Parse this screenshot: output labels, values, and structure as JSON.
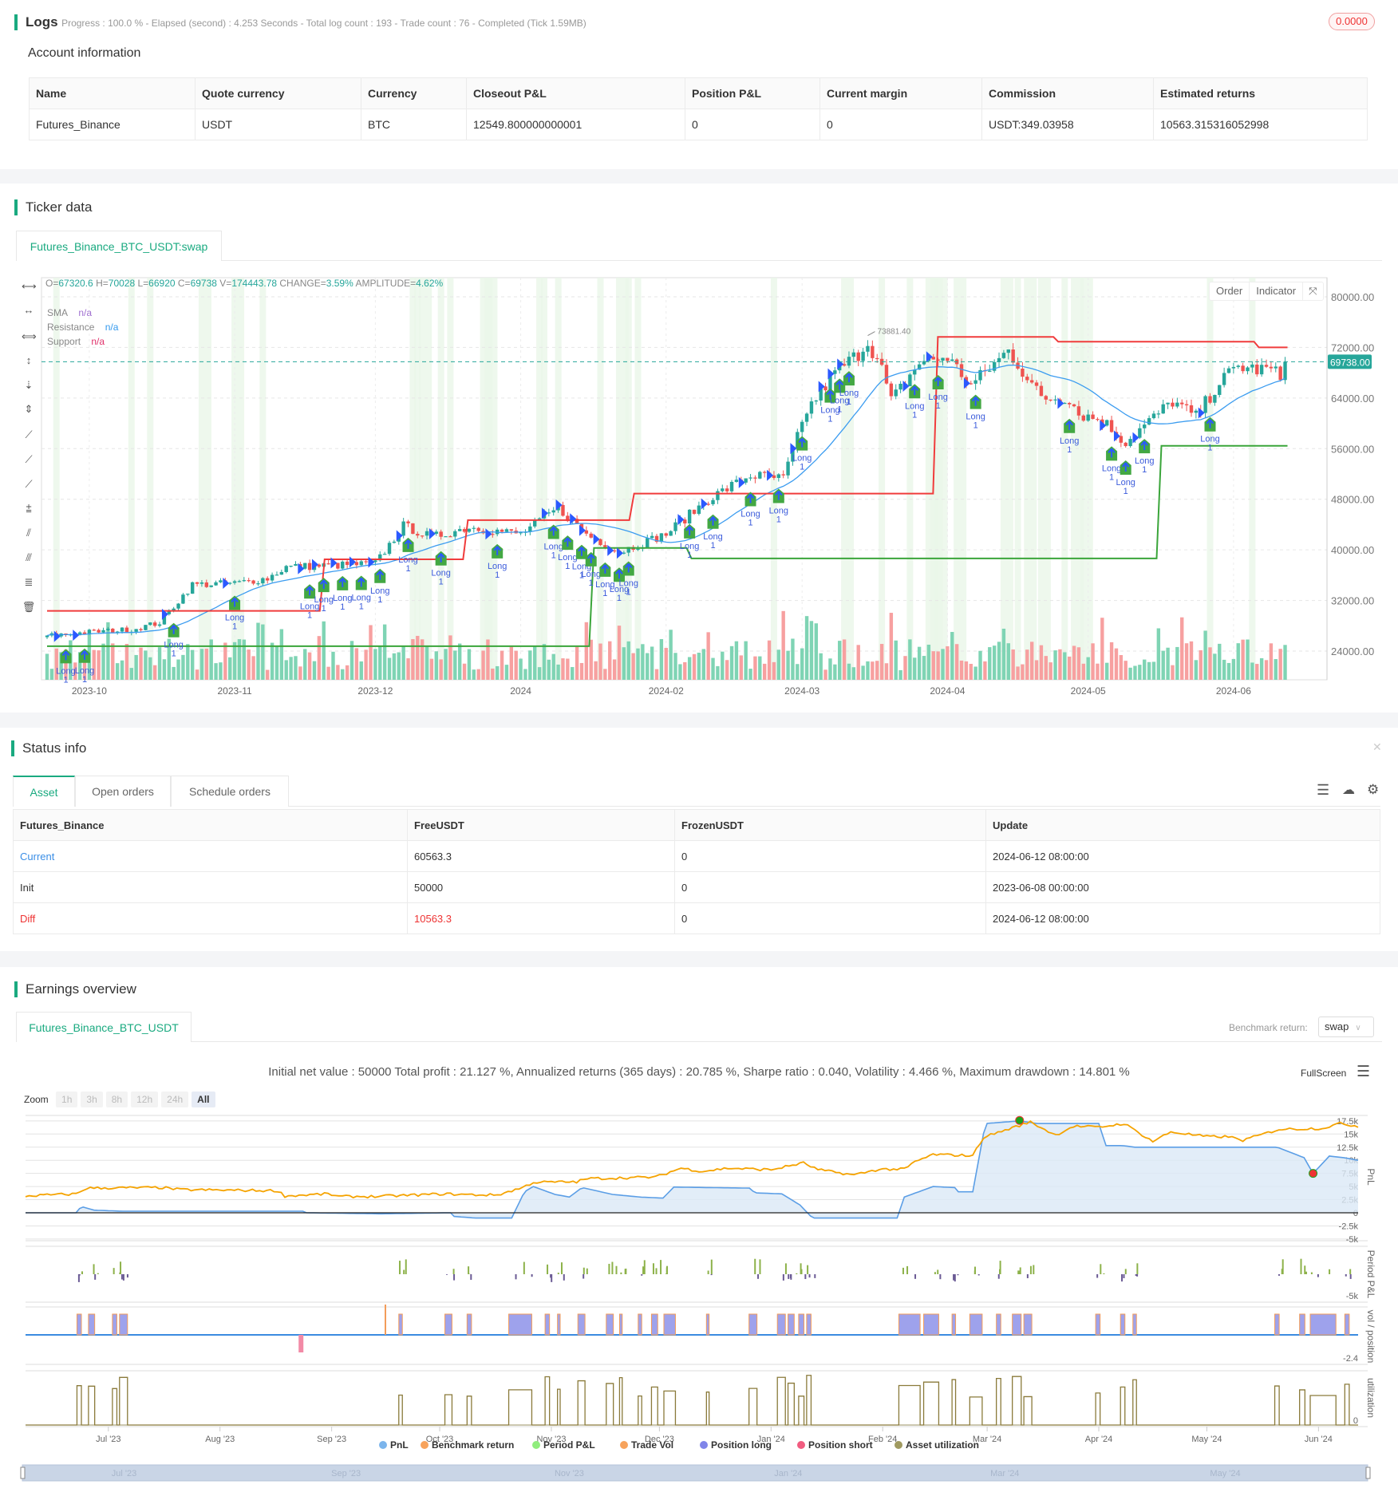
{
  "logs": {
    "title": "Logs",
    "summary": "Progress : 100.0 % - Elapsed (second) : 4.253  Seconds - Total log count : 193 - Trade count : 76 - Completed (Tick 1.59MB)",
    "badge": "0.0000"
  },
  "account": {
    "title": "Account information",
    "headers": [
      "Name",
      "Quote currency",
      "Currency",
      "Closeout P&L",
      "Position P&L",
      "Current margin",
      "Commission",
      "Estimated returns"
    ],
    "row": [
      "Futures_Binance",
      "USDT",
      "BTC",
      "12549.800000000001",
      "0",
      "0",
      "USDT:349.03958",
      "10563.315316052998"
    ]
  },
  "ticker": {
    "title": "Ticker data",
    "tab": "Futures_Binance_BTC_USDT:swap",
    "ohlc": {
      "o_label": "O=",
      "o": "67320.6",
      "h_label": "H=",
      "h": "70028",
      "l_label": "L=",
      "l": "66920",
      "c_label": "C=",
      "c": "69738",
      "v_label": "V=",
      "v": "174443.78",
      "change_label": "CHANGE=",
      "change": "3.59%",
      "amp_label": "AMPLITUDE=",
      "amp": "4.62%"
    },
    "legend": [
      {
        "name": "SMA",
        "value": "n/a",
        "color": "#a070d0"
      },
      {
        "name": "Resistance",
        "value": "n/a",
        "color": "#3399ee"
      },
      {
        "name": "Support",
        "value": "n/a",
        "color": "#e0306a"
      }
    ],
    "buttons": {
      "order": "Order",
      "indicator": "Indicator"
    },
    "price_ticks": [
      "80000.00",
      "72000.00",
      "64000.00",
      "56000.00",
      "48000.00",
      "40000.00",
      "32000.00",
      "24000.00"
    ],
    "last_price": "69738.00",
    "peak_label": "73881.40",
    "date_ticks": [
      "2023-10",
      "2023-11",
      "2023-12",
      "2024",
      "2024-02",
      "2024-03",
      "2024-04",
      "2024-05",
      "2024-06"
    ],
    "marker": {
      "label": "Long",
      "qty": "1"
    },
    "price_path": [
      [
        0,
        26400
      ],
      [
        9,
        27000
      ],
      [
        18,
        27400
      ],
      [
        24,
        28500
      ],
      [
        31,
        34500
      ],
      [
        40,
        34700
      ],
      [
        47,
        35500
      ],
      [
        51,
        37300
      ],
      [
        60,
        37500
      ],
      [
        70,
        37800
      ],
      [
        76,
        43800
      ],
      [
        82,
        42000
      ],
      [
        90,
        43600
      ],
      [
        101,
        42500
      ],
      [
        109,
        46600
      ],
      [
        115,
        42500
      ],
      [
        122,
        39700
      ],
      [
        132,
        42500
      ],
      [
        141,
        48000
      ],
      [
        150,
        51800
      ],
      [
        157,
        51200
      ],
      [
        162,
        62000
      ],
      [
        168,
        68000
      ],
      [
        173,
        71000
      ],
      [
        175,
        73000
      ],
      [
        178,
        68500
      ],
      [
        180,
        63500
      ],
      [
        186,
        69600
      ],
      [
        192,
        70500
      ],
      [
        197,
        66000
      ],
      [
        205,
        71500
      ],
      [
        212,
        64000
      ],
      [
        218,
        64000
      ],
      [
        220,
        61500
      ],
      [
        225,
        60500
      ],
      [
        230,
        57000
      ],
      [
        233,
        59000
      ],
      [
        240,
        63500
      ],
      [
        245,
        61000
      ],
      [
        250,
        66500
      ],
      [
        254,
        69000
      ],
      [
        258,
        68500
      ],
      [
        261,
        68500
      ],
      [
        263,
        67300
      ],
      [
        264,
        69738
      ]
    ],
    "resistance": [
      [
        0,
        30350
      ],
      [
        48,
        38500
      ],
      [
        73,
        44700
      ],
      [
        102,
        48900
      ],
      [
        155,
        73660
      ],
      [
        176,
        72900
      ],
      [
        211,
        72000
      ],
      [
        216,
        72000
      ]
    ],
    "support": [
      [
        0,
        24770
      ],
      [
        95,
        40300
      ],
      [
        112,
        38650
      ],
      [
        194,
        56450
      ],
      [
        216,
        56450
      ]
    ],
    "colors": {
      "up": "#26a69a",
      "down": "#ef5350",
      "resistance": "#f03c3c",
      "support": "#3aa53a",
      "sma": "#3b9cf0"
    }
  },
  "status": {
    "title": "Status info",
    "tabs": [
      "Asset",
      "Open orders",
      "Schedule orders"
    ],
    "headers": [
      "Futures_Binance",
      "FreeUSDT",
      "FrozenUSDT",
      "Update"
    ],
    "rows": [
      [
        "Current",
        "60563.3",
        "0",
        "2024-06-12 08:00:00"
      ],
      [
        "Init",
        "50000",
        "0",
        "2023-06-08 00:00:00"
      ],
      [
        "Diff",
        "10563.3",
        "0",
        "2024-06-12 08:00:00"
      ]
    ]
  },
  "earnings": {
    "title": "Earnings overview",
    "tab": "Futures_Binance_BTC_USDT",
    "benchmark_label": "Benchmark return:",
    "benchmark_value": "swap",
    "summary": "Initial net value : 50000 Total profit : 21.127 %, Annualized returns (365 days) : 20.785 %, Sharpe ratio : 0.040, Volatility : 4.466 %, Maximum drawdown : 14.801 %",
    "fullscreen": "FullScreen",
    "zoom_label": "Zoom",
    "zoom_options": [
      "1h",
      "3h",
      "8h",
      "12h",
      "24h",
      "All"
    ],
    "pnl_ticks": [
      "17.5k",
      "15k",
      "12.5k",
      "10k",
      "7.5k",
      "5k",
      "2.5k",
      "0",
      "-2.5k",
      "-5k"
    ],
    "period_tick": "-5k",
    "vol_tick": "-2.4",
    "util_tick": "0",
    "panel_titles": [
      "PnL",
      "Period P&L",
      "vol / position",
      "utilization"
    ],
    "date_ticks": [
      "Jul '23",
      "Aug '23",
      "Sep '23",
      "Oct '23",
      "Nov '23",
      "Dec '23",
      "Jan '24",
      "Feb '24",
      "Mar '24",
      "Apr '24",
      "May '24",
      "Jun '24"
    ],
    "nav_ticks": [
      "Jul '23",
      "Sep '23",
      "Nov '23",
      "Jan '24",
      "Mar '24",
      "May '24"
    ],
    "legend": [
      {
        "name": "PnL",
        "color": "#7cb5ec"
      },
      {
        "name": "Benchmark return",
        "color": "#f7a35c"
      },
      {
        "name": "Period P&L",
        "color": "#90ed7d"
      },
      {
        "name": "Trade Vol",
        "color": "#f7a35c"
      },
      {
        "name": "Position long",
        "color": "#8085e9"
      },
      {
        "name": "Position short",
        "color": "#f15c80"
      },
      {
        "name": "Asset utilization",
        "color": "#a09a60"
      }
    ],
    "pnl": [
      [
        0,
        0
      ],
      [
        14,
        0
      ],
      [
        15.5,
        1200
      ],
      [
        19,
        500
      ],
      [
        27,
        300
      ],
      [
        77,
        300
      ],
      [
        78,
        0
      ],
      [
        99,
        -200
      ],
      [
        118,
        0
      ],
      [
        119,
        -700
      ],
      [
        125,
        -1000
      ],
      [
        135,
        -1000
      ],
      [
        138.5,
        4000
      ],
      [
        141,
        5000
      ],
      [
        147,
        3500
      ],
      [
        151,
        3000
      ],
      [
        154.5,
        4800
      ],
      [
        163,
        3500
      ],
      [
        170.5,
        3000
      ],
      [
        177,
        2800
      ],
      [
        180,
        4900
      ],
      [
        190,
        4800
      ],
      [
        201,
        4700
      ],
      [
        202.5,
        3800
      ],
      [
        210,
        3600
      ],
      [
        215,
        1500
      ],
      [
        218.5,
        -1000
      ],
      [
        242,
        -1000
      ],
      [
        244,
        3000
      ],
      [
        252,
        5000
      ],
      [
        258,
        4800
      ],
      [
        259,
        4000
      ],
      [
        263,
        4000
      ],
      [
        266.5,
        17000
      ],
      [
        276,
        17500
      ],
      [
        281,
        17000
      ],
      [
        298,
        17000
      ],
      [
        300,
        12800
      ],
      [
        304.5,
        12800
      ],
      [
        308,
        12500
      ],
      [
        347.5,
        12500
      ],
      [
        355,
        10500
      ],
      [
        357.5,
        7500
      ],
      [
        362,
        10800
      ],
      [
        366,
        10500
      ],
      [
        370,
        10000
      ]
    ],
    "benchmark": [
      [
        0,
        3200
      ],
      [
        14,
        3600
      ],
      [
        17,
        4700
      ],
      [
        38,
        4800
      ],
      [
        43,
        4400
      ],
      [
        70,
        4200
      ],
      [
        72,
        3200
      ],
      [
        84,
        3600
      ],
      [
        87,
        3100
      ],
      [
        97,
        3100
      ],
      [
        109,
        3400
      ],
      [
        116,
        3600
      ],
      [
        126,
        3400
      ],
      [
        131,
        3400
      ],
      [
        138,
        4800
      ],
      [
        141,
        5800
      ],
      [
        153,
        5900
      ],
      [
        156,
        6500
      ],
      [
        175,
        6800
      ],
      [
        182,
        8500
      ],
      [
        188,
        7900
      ],
      [
        195,
        8500
      ],
      [
        207,
        8200
      ],
      [
        216,
        9500
      ],
      [
        220,
        8200
      ],
      [
        230,
        7200
      ],
      [
        237,
        8300
      ],
      [
        244,
        8300
      ],
      [
        247,
        9700
      ],
      [
        252,
        11100
      ],
      [
        263,
        10900
      ],
      [
        266,
        14400
      ],
      [
        270,
        15300
      ],
      [
        279,
        17300
      ],
      [
        286,
        14800
      ],
      [
        291,
        16500
      ],
      [
        298,
        16300
      ],
      [
        305,
        17000
      ],
      [
        313,
        13600
      ],
      [
        318,
        15400
      ],
      [
        328,
        14500
      ],
      [
        334,
        14500
      ],
      [
        338,
        13800
      ],
      [
        348,
        15900
      ],
      [
        360,
        16100
      ],
      [
        365,
        17000
      ],
      [
        370,
        16500
      ]
    ]
  }
}
